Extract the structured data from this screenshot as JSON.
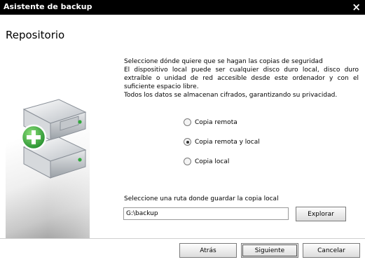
{
  "window": {
    "title": "Asistente de backup",
    "close_icon": "×"
  },
  "header": {
    "title": "Repositorio"
  },
  "description": {
    "lines": [
      "Seleccione dónde quiere que se hagan las copias de seguridad",
      "El dispositivo local puede ser cualquier disco duro local, disco duro extraíble o unidad de red accesible desde este ordenador y con el suficiente espacio libre.",
      "Todos los datos se almacenan cifrados, garantizando su privacidad."
    ]
  },
  "options": [
    {
      "label": "Copia remota",
      "selected": false
    },
    {
      "label": "Copia remota y local",
      "selected": true
    },
    {
      "label": "Copia local",
      "selected": false
    }
  ],
  "path": {
    "label": "Seleccione una ruta donde guardar la copia local",
    "value": "G:\\backup",
    "browse_label": "Explorar"
  },
  "buttons": {
    "back": "Atrás",
    "next": "Siguiente",
    "cancel": "Cancelar"
  },
  "colors": {
    "accent_green": "#2fa83a",
    "titlebar": "#000000"
  }
}
